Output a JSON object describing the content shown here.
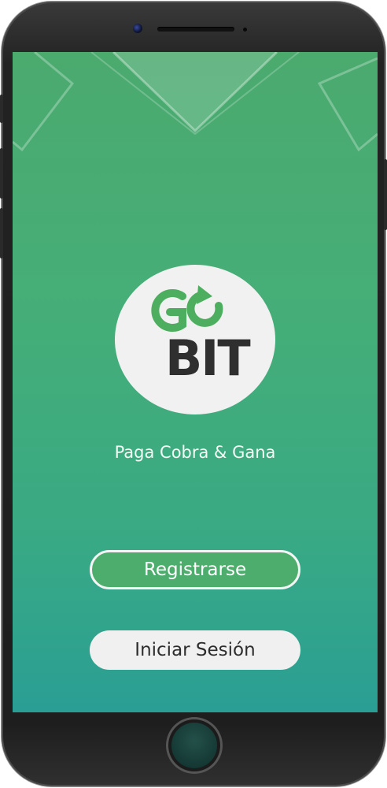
{
  "brand": {
    "logo_top": "GO",
    "logo_bottom": "BIT",
    "tagline": "Paga Cobra & Gana"
  },
  "buttons": {
    "register_label": "Registrarse",
    "login_label": "Iniciar Sesión"
  },
  "colors": {
    "screen_top": "#4baa6e",
    "screen_bottom": "#2a9e94",
    "logo_green": "#4cae5e",
    "logo_dark": "#2f2f2f",
    "register_fill": "#4cad6d",
    "login_fill": "#f0f0f0"
  },
  "icons": {
    "logo_arrow": "circular-arrow-icon"
  }
}
